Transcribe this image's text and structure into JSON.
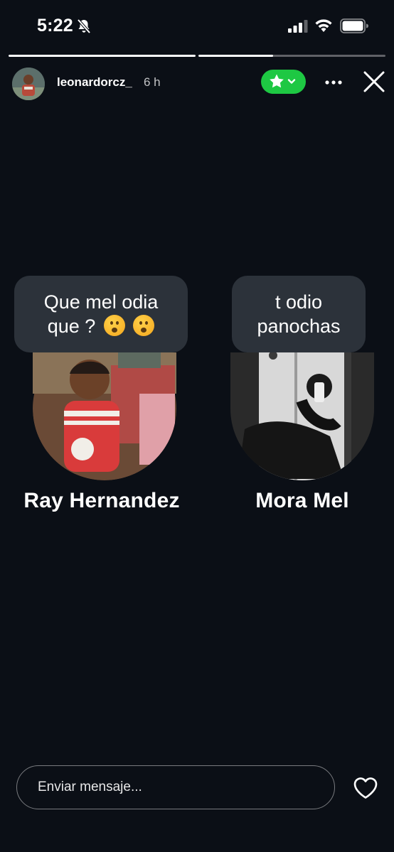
{
  "status_bar": {
    "time": "5:22",
    "icons": [
      "bell-slash-icon",
      "signal-icon",
      "wifi-icon",
      "battery-icon"
    ]
  },
  "progress": [
    1.0,
    0.4
  ],
  "header": {
    "username": "leonardorcz_",
    "time_ago": "6 h",
    "close_friends_icon": "star-icon",
    "close_friends_color": "#1ec843",
    "more_icon": "more-dots-icon",
    "close_icon": "close-icon"
  },
  "cards": [
    {
      "bubble_line1": "Que mel odia",
      "bubble_line2": "que ?",
      "emojis": [
        "frowning-face-emoji",
        "frowning-face-emoji"
      ],
      "name": "Ray Hernandez"
    },
    {
      "bubble_line1": "t odio",
      "bubble_line2": "panochas",
      "name": "Mora Mel"
    }
  ],
  "footer": {
    "message_placeholder": "Enviar mensaje...",
    "like_icon": "heart-icon"
  },
  "colors": {
    "background": "#0b0f16",
    "bubble": "#2c323a",
    "accent_green": "#1ec843"
  }
}
